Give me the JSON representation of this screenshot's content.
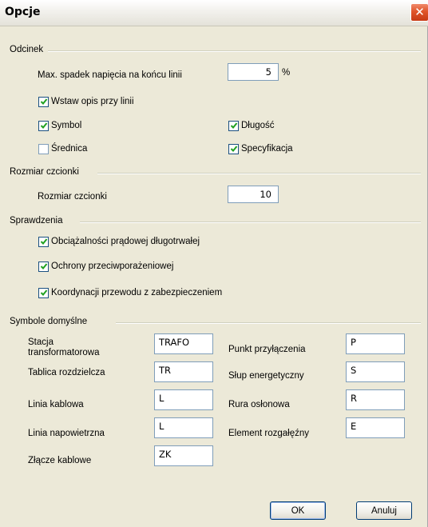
{
  "window": {
    "title": "Opcje",
    "close_symbol": "✕"
  },
  "sections": {
    "odcinek": "Odcinek",
    "rozmiar": "Rozmiar czcionki",
    "sprawdzenia": "Sprawdzenia",
    "symbole": "Symbole domyślne"
  },
  "odcinek": {
    "max_drop_label": "Max. spadek napięcia na końcu linii",
    "max_drop_value": "5",
    "max_drop_unit": "%",
    "insert_desc": {
      "label": "Wstaw opis przy linii",
      "checked": true
    },
    "symbol": {
      "label": "Symbol",
      "checked": true
    },
    "dlugosc": {
      "label": "Długość",
      "checked": true
    },
    "srednica": {
      "label": "Średnica",
      "checked": false
    },
    "specyfikacja": {
      "label": "Specyfikacja",
      "checked": true
    }
  },
  "rozmiar": {
    "label": "Rozmiar czcionki",
    "value": "10"
  },
  "sprawdzenia": {
    "obciazalnosc": {
      "label": "Obciążalności prądowej długotrwałej",
      "checked": true
    },
    "ochrona": {
      "label": "Ochrony przeciwporażeniowej",
      "checked": true
    },
    "koordynacja": {
      "label": "Koordynacji przewodu z zabezpieczeniem",
      "checked": true
    }
  },
  "symbole": {
    "stacja": {
      "label": "Stacja transformatorowa",
      "value": "TRAFO"
    },
    "tablica": {
      "label": "Tablica rozdzielcza",
      "value": "TR"
    },
    "kablowa": {
      "label": "Linia kablowa",
      "value": "L"
    },
    "napowietrzna": {
      "label": "Linia napowietrzna",
      "value": "L"
    },
    "zlacze": {
      "label": "Złącze kablowe",
      "value": "ZK"
    },
    "punkt": {
      "label": "Punkt przyłączenia",
      "value": "P"
    },
    "slup": {
      "label": "Słup energetyczny",
      "value": "S"
    },
    "rura": {
      "label": "Rura osłonowa",
      "value": "R"
    },
    "element": {
      "label": "Element rozgałęźny",
      "value": "E"
    }
  },
  "buttons": {
    "ok": "OK",
    "cancel": "Anuluj"
  }
}
